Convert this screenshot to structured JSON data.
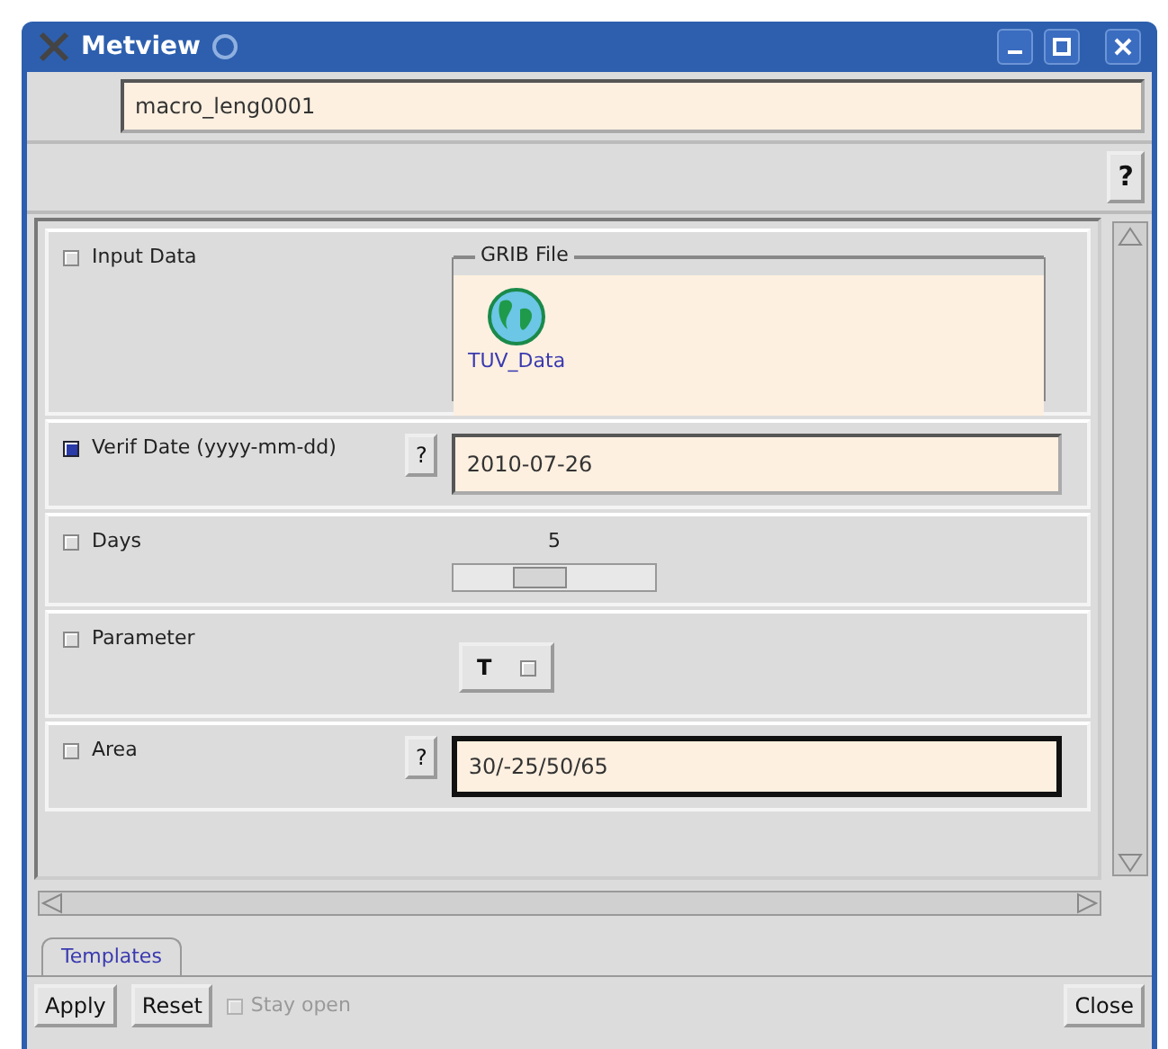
{
  "window": {
    "title": "Metview"
  },
  "name_field": {
    "value": "macro_leng0001"
  },
  "help_button": "?",
  "rows": [
    {
      "kind": "file",
      "label": "Input Data",
      "checked": false,
      "group_title": "GRIB File",
      "icon_label": "TUV_Data"
    },
    {
      "kind": "text",
      "label": "Verif Date (yyyy-mm-dd)",
      "checked": true,
      "help": "?",
      "value": "2010-07-26",
      "focused": false
    },
    {
      "kind": "slider",
      "label": "Days",
      "checked": false,
      "reading": "5",
      "level": 0.4
    },
    {
      "kind": "option",
      "label": "Parameter",
      "checked": false,
      "value": "T"
    },
    {
      "kind": "text",
      "label": "Area",
      "checked": false,
      "help": "?",
      "value": "30/-25/50/65",
      "focused": true
    }
  ],
  "tabs": [
    {
      "label": "Templates",
      "selected": true
    }
  ],
  "buttons": [
    {
      "label": "Apply"
    },
    {
      "label": "Reset"
    }
  ],
  "stay_open": {
    "label": "Stay open",
    "checked": false,
    "disabled": true
  },
  "close_button": "Close"
}
